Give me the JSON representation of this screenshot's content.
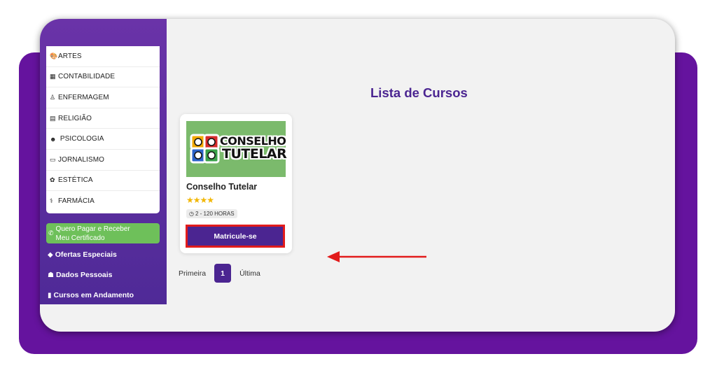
{
  "sidebar": {
    "categories": [
      {
        "icon": "palette-icon",
        "glyph": "🎨",
        "label": "ARTES"
      },
      {
        "icon": "calculator-icon",
        "glyph": "▦",
        "label": "CONTABILIDADE"
      },
      {
        "icon": "nurse-icon",
        "glyph": "♙",
        "label": "ENFERMAGEM"
      },
      {
        "icon": "bible-icon",
        "glyph": "▤",
        "label": "RELIGIÃO"
      },
      {
        "icon": "brain-head-icon",
        "glyph": "☻",
        "label": " PSICOLOGIA"
      },
      {
        "icon": "newspaper-icon",
        "glyph": "▭",
        "label": "JORNALISMO"
      },
      {
        "icon": "spa-icon",
        "glyph": "✿",
        "label": "ESTÉTICA"
      },
      {
        "icon": "pills-icon",
        "glyph": "⚕",
        "label": "FARMÁCIA"
      }
    ],
    "certificate_button": "Quero Pagar e Receber Meu Certificado",
    "links": {
      "special_offers": "Ofertas Especiais",
      "personal_data": "Dados Pessoais",
      "courses_in_progress": "Cursos em Andamento"
    }
  },
  "main": {
    "title": "Lista de Cursos",
    "course": {
      "logo_line1": "CONSELHO",
      "logo_line2": "TUTELAR",
      "title": "Conselho Tutelar",
      "stars": "★★★★",
      "rating": 4,
      "hours": "2 - 120 HORAS",
      "enroll_label": "Matricule-se"
    },
    "pagination": {
      "first": "Primeira",
      "current": "1",
      "last": "Última"
    }
  },
  "colors": {
    "brand_purple": "#4b2591",
    "background_purple": "#65139e",
    "green": "#6ec05a",
    "highlight_red": "#e21b1b",
    "star": "#f2b705"
  }
}
